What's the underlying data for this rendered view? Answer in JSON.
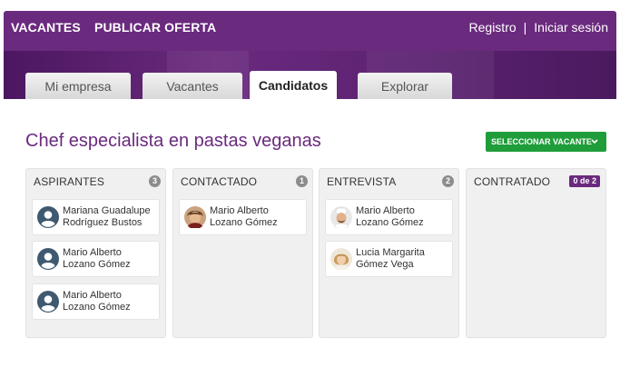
{
  "nav": {
    "vacantes": "VACANTES",
    "publicar": "PUBLICAR OFERTA",
    "registro": "Registro",
    "separator": "|",
    "login": "Iniciar sesión"
  },
  "tabs": [
    {
      "label": "Mi empresa",
      "active": false
    },
    {
      "label": "Vacantes",
      "active": false
    },
    {
      "label": "Candidatos",
      "active": true
    },
    {
      "label": "Explorar",
      "active": false
    }
  ],
  "page": {
    "title": "Chef especialista en pastas veganas",
    "select_button": "SELECCIONAR VACANTE",
    "select_icon": "chevron-down-icon"
  },
  "colors": {
    "brand": "#6a2a7e",
    "accent_green": "#1f9d3a",
    "badge_gray": "#8c8c8c"
  },
  "columns": [
    {
      "title": "ASPIRANTES",
      "count": "3",
      "cards": [
        {
          "line1": "Mariana Guadalupe",
          "line2": "Rodríguez Bustos",
          "avatar": "user-placeholder-icon"
        },
        {
          "line1": "Mario Alberto",
          "line2": "Lozano Gómez",
          "avatar": "user-placeholder-icon"
        },
        {
          "line1": "Mario Alberto",
          "line2": "Lozano Gómez",
          "avatar": "user-placeholder-icon"
        }
      ]
    },
    {
      "title": "CONTACTADO",
      "count": "1",
      "cards": [
        {
          "line1": "Mario Alberto",
          "line2": "Lozano Gómez",
          "avatar": "user-photo-man"
        }
      ]
    },
    {
      "title": "ENTREVISTA",
      "count": "2",
      "cards": [
        {
          "line1": "Mario Alberto",
          "line2": "Lozano Gómez",
          "avatar": "user-photo-chef"
        },
        {
          "line1": "Lucia Margarita",
          "line2": "Gómez Vega",
          "avatar": "user-photo-woman"
        }
      ]
    },
    {
      "title": "CONTRATADO",
      "count": "0 de 2",
      "cards": []
    }
  ]
}
